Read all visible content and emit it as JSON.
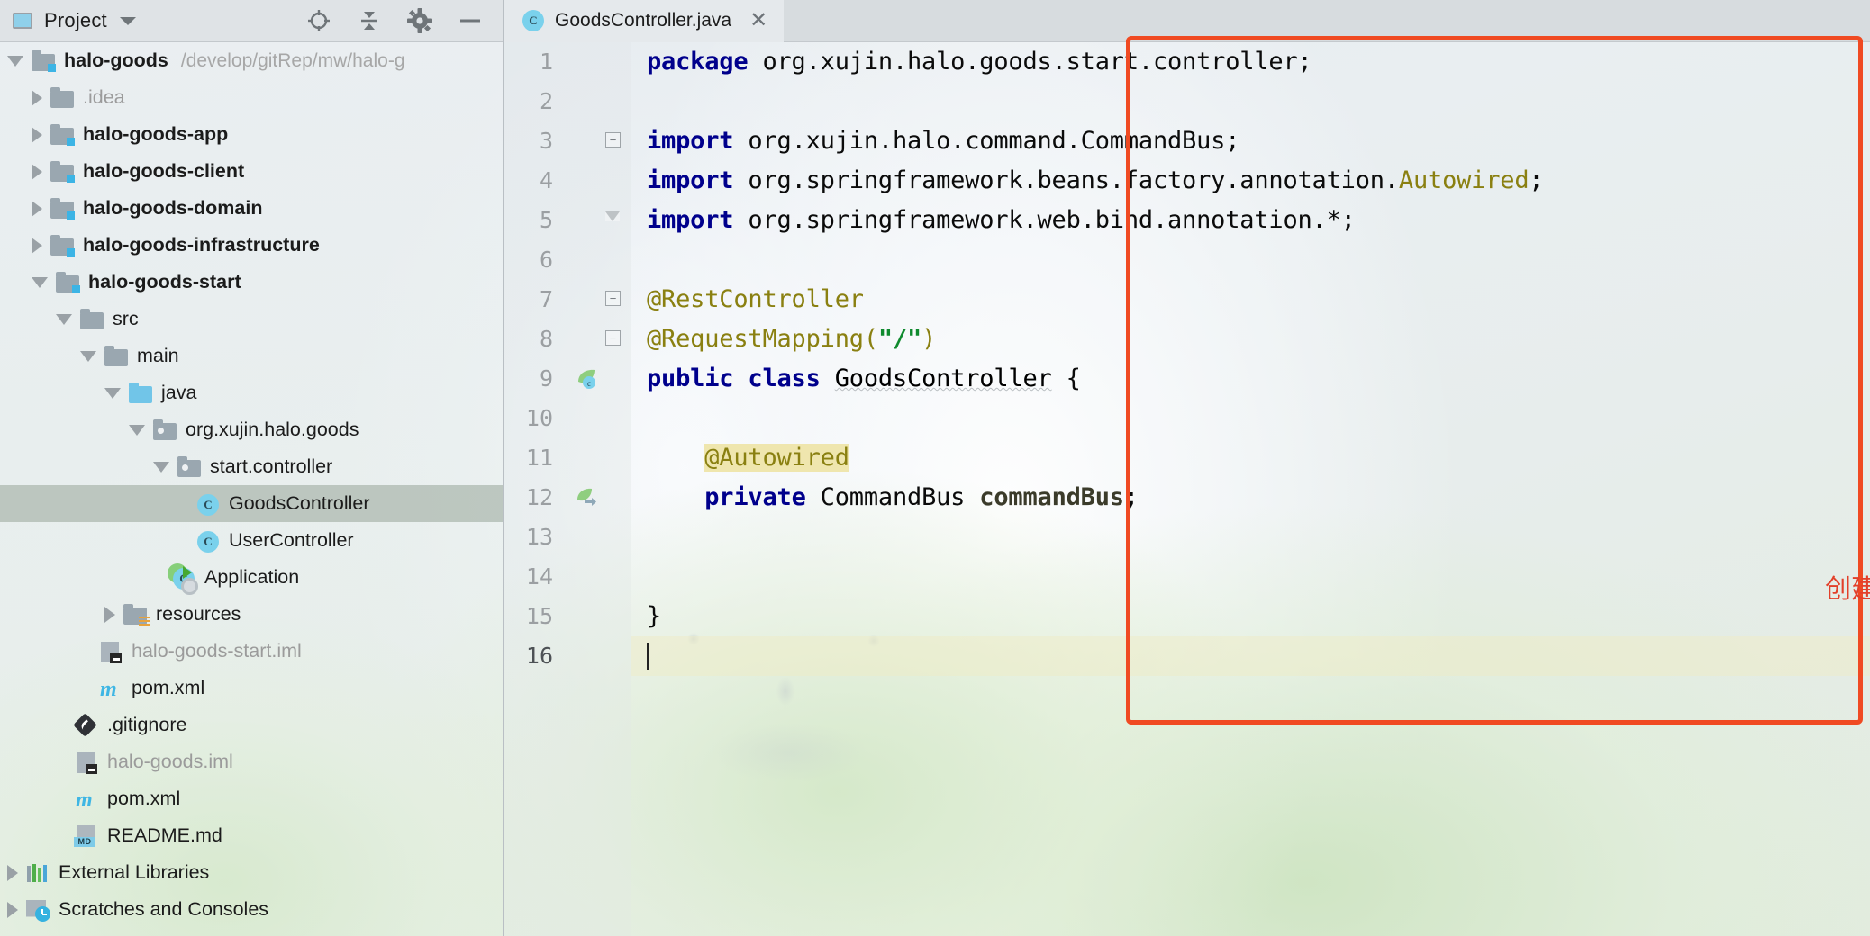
{
  "project_panel": {
    "title": "Project",
    "title_caret_icon": "chevron-down-icon",
    "actions": [
      {
        "name": "locate-icon",
        "label": "Select Opened File"
      },
      {
        "name": "collapse-all-icon",
        "label": "Collapse All"
      },
      {
        "name": "gear-icon",
        "label": "Settings"
      },
      {
        "name": "minimize-icon",
        "label": "Hide"
      }
    ],
    "tree": [
      {
        "label": "halo-goods",
        "path": "/develop/gitRep/mw/halo-g",
        "icon": "module-folder-icon",
        "indent": 0,
        "arrow": "down",
        "bold": true,
        "dim": false,
        "selected": false
      },
      {
        "label": ".idea",
        "path": "",
        "icon": "folder-icon",
        "indent": 1,
        "arrow": "right",
        "bold": false,
        "dim": true,
        "selected": false
      },
      {
        "label": "halo-goods-app",
        "path": "",
        "icon": "module-folder-icon",
        "indent": 1,
        "arrow": "right",
        "bold": true,
        "dim": false,
        "selected": false
      },
      {
        "label": "halo-goods-client",
        "path": "",
        "icon": "module-folder-icon",
        "indent": 1,
        "arrow": "right",
        "bold": true,
        "dim": false,
        "selected": false
      },
      {
        "label": "halo-goods-domain",
        "path": "",
        "icon": "module-folder-icon",
        "indent": 1,
        "arrow": "right",
        "bold": true,
        "dim": false,
        "selected": false
      },
      {
        "label": "halo-goods-infrastructure",
        "path": "",
        "icon": "module-folder-icon",
        "indent": 1,
        "arrow": "right",
        "bold": true,
        "dim": false,
        "selected": false
      },
      {
        "label": "halo-goods-start",
        "path": "",
        "icon": "module-folder-icon",
        "indent": 1,
        "arrow": "down",
        "bold": true,
        "dim": false,
        "selected": false
      },
      {
        "label": "src",
        "path": "",
        "icon": "folder-icon",
        "indent": 2,
        "arrow": "down",
        "bold": false,
        "dim": false,
        "selected": false
      },
      {
        "label": "main",
        "path": "",
        "icon": "folder-icon",
        "indent": 3,
        "arrow": "down",
        "bold": false,
        "dim": false,
        "selected": false
      },
      {
        "label": "java",
        "path": "",
        "icon": "source-folder-icon",
        "indent": 4,
        "arrow": "down",
        "bold": false,
        "dim": false,
        "selected": false
      },
      {
        "label": "org.xujin.halo.goods",
        "path": "",
        "icon": "package-icon",
        "indent": 5,
        "arrow": "down",
        "bold": false,
        "dim": false,
        "selected": false
      },
      {
        "label": "start.controller",
        "path": "",
        "icon": "package-icon",
        "indent": 6,
        "arrow": "down",
        "bold": false,
        "dim": false,
        "selected": false
      },
      {
        "label": "GoodsController",
        "path": "",
        "icon": "java-class-icon",
        "indent": 7,
        "arrow": "none",
        "bold": false,
        "dim": false,
        "selected": true
      },
      {
        "label": "UserController",
        "path": "",
        "icon": "java-class-icon",
        "indent": 7,
        "arrow": "none",
        "bold": false,
        "dim": false,
        "selected": false
      },
      {
        "label": "Application",
        "path": "",
        "icon": "spring-boot-runnable-class-icon",
        "indent": 6,
        "arrow": "none",
        "bold": false,
        "dim": false,
        "selected": false
      },
      {
        "label": "resources",
        "path": "",
        "icon": "resources-folder-icon",
        "indent": 4,
        "arrow": "right",
        "bold": false,
        "dim": false,
        "selected": false
      },
      {
        "label": "halo-goods-start.iml",
        "path": "",
        "icon": "iml-file-icon",
        "indent": 3,
        "arrow": "none",
        "bold": false,
        "dim": true,
        "selected": false
      },
      {
        "label": "pom.xml",
        "path": "",
        "icon": "maven-file-icon",
        "indent": 3,
        "arrow": "none",
        "bold": false,
        "dim": false,
        "selected": false
      },
      {
        "label": ".gitignore",
        "path": "",
        "icon": "git-file-icon",
        "indent": 2,
        "arrow": "none",
        "bold": false,
        "dim": false,
        "selected": false
      },
      {
        "label": "halo-goods.iml",
        "path": "",
        "icon": "iml-file-icon",
        "indent": 2,
        "arrow": "none",
        "bold": false,
        "dim": true,
        "selected": false
      },
      {
        "label": "pom.xml",
        "path": "",
        "icon": "maven-file-icon",
        "indent": 2,
        "arrow": "none",
        "bold": false,
        "dim": false,
        "selected": false
      },
      {
        "label": "README.md",
        "path": "",
        "icon": "markdown-file-icon",
        "indent": 2,
        "arrow": "none",
        "bold": false,
        "dim": false,
        "selected": false
      },
      {
        "label": "External Libraries",
        "path": "",
        "icon": "external-libraries-icon",
        "indent": 0,
        "arrow": "right",
        "bold": false,
        "dim": false,
        "selected": false
      },
      {
        "label": "Scratches and Consoles",
        "path": "",
        "icon": "scratches-icon",
        "indent": 0,
        "arrow": "right",
        "bold": false,
        "dim": false,
        "selected": false
      }
    ]
  },
  "editor": {
    "tab": {
      "label": "GoodsController.java",
      "icon": "java-class-icon",
      "close_icon": "close-icon"
    },
    "current_line": 16,
    "lines": [
      {
        "n": 1,
        "fold": "none",
        "gmark": "",
        "tokens": [
          {
            "t": "package",
            "c": "kw"
          },
          {
            "t": " org.xujin.halo.goods.start.controller;",
            "c": "plain"
          }
        ]
      },
      {
        "n": 2,
        "fold": "none",
        "gmark": "",
        "tokens": []
      },
      {
        "n": 3,
        "fold": "start",
        "gmark": "",
        "tokens": [
          {
            "t": "import",
            "c": "kw"
          },
          {
            "t": " org.xujin.halo.command.CommandBus;",
            "c": "plain"
          }
        ]
      },
      {
        "n": 4,
        "fold": "none",
        "gmark": "",
        "tokens": [
          {
            "t": "import",
            "c": "kw"
          },
          {
            "t": " org.springframework.beans.factory.annotation.",
            "c": "plain"
          },
          {
            "t": "Autowired",
            "c": "ann"
          },
          {
            "t": ";",
            "c": "plain"
          }
        ]
      },
      {
        "n": 5,
        "fold": "end",
        "gmark": "",
        "tokens": [
          {
            "t": "import",
            "c": "kw"
          },
          {
            "t": " org.springframework.web.bind.annotation.*;",
            "c": "plain"
          }
        ]
      },
      {
        "n": 6,
        "fold": "none",
        "gmark": "",
        "tokens": []
      },
      {
        "n": 7,
        "fold": "start",
        "gmark": "",
        "tokens": [
          {
            "t": "@RestController",
            "c": "ann"
          }
        ]
      },
      {
        "n": 8,
        "fold": "start",
        "gmark": "",
        "tokens": [
          {
            "t": "@RequestMapping(",
            "c": "ann"
          },
          {
            "t": "\"/\"",
            "c": "str"
          },
          {
            "t": ")",
            "c": "ann"
          }
        ]
      },
      {
        "n": 9,
        "fold": "none",
        "gmark": "bean-class-marker",
        "tokens": [
          {
            "t": "public class",
            "c": "kw"
          },
          {
            "t": " ",
            "c": "plain"
          },
          {
            "t": "GoodsController",
            "c": "wavy"
          },
          {
            "t": " {",
            "c": "plain"
          }
        ]
      },
      {
        "n": 10,
        "fold": "none",
        "gmark": "",
        "tokens": []
      },
      {
        "n": 11,
        "fold": "none",
        "gmark": "",
        "tokens": [
          {
            "t": "    ",
            "c": "plain"
          },
          {
            "t": "@Autowired",
            "c": "ann hl-annot"
          }
        ]
      },
      {
        "n": 12,
        "fold": "none",
        "gmark": "autowired-marker",
        "tokens": [
          {
            "t": "    ",
            "c": "plain"
          },
          {
            "t": "private",
            "c": "kw"
          },
          {
            "t": " CommandBus ",
            "c": "plain"
          },
          {
            "t": "commandBus",
            "c": "field"
          },
          {
            "t": ";",
            "c": "plain"
          }
        ]
      },
      {
        "n": 13,
        "fold": "none",
        "gmark": "",
        "tokens": []
      },
      {
        "n": 14,
        "fold": "none",
        "gmark": "",
        "tokens": []
      },
      {
        "n": 15,
        "fold": "none",
        "gmark": "",
        "tokens": [
          {
            "t": "}",
            "c": "plain"
          }
        ]
      },
      {
        "n": 16,
        "fold": "none",
        "gmark": "",
        "tokens": []
      }
    ]
  },
  "annotation": {
    "text": "创建之后的Controller",
    "color": "#e2402a",
    "rect_color": "#f04a22"
  },
  "colors": {
    "selection": "#b2bdb4",
    "keyword": "#00008c",
    "annotation_token": "#8a8011",
    "string": "#0f8a2e",
    "highlight_bg": "#efe6ae",
    "accent_blue": "#3cb4e5"
  }
}
